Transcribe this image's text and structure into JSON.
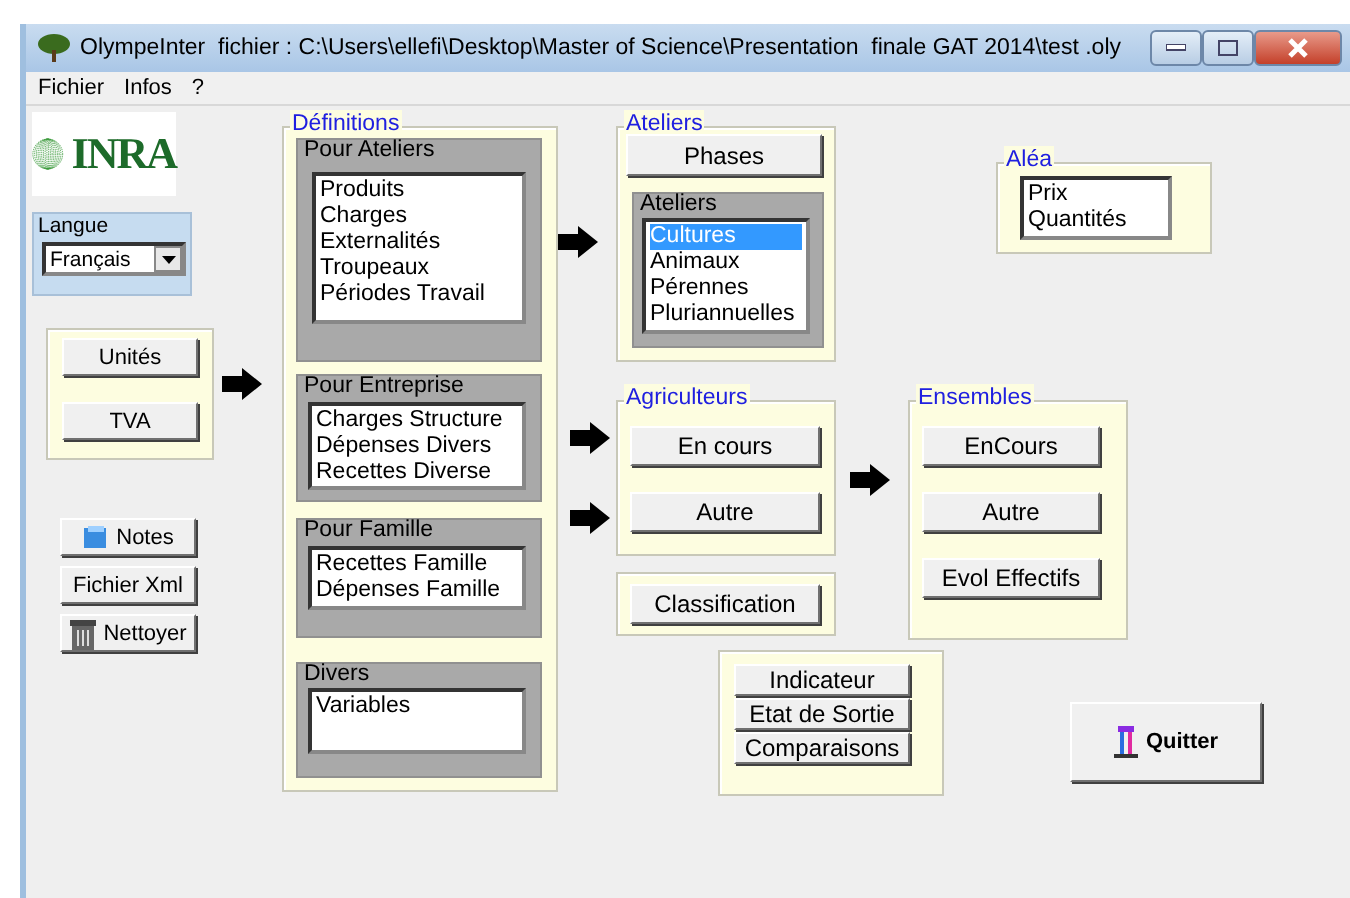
{
  "window": {
    "title": "OlympeInter  fichier : C:\\Users\\ellefi\\Desktop\\Master of Science\\Presentation  finale GAT 2014\\test .oly"
  },
  "menu": [
    "Fichier",
    "Infos",
    "?"
  ],
  "logo": {
    "text": "INRA"
  },
  "langue": {
    "title": "Langue",
    "value": "Français"
  },
  "settings_buttons": [
    "Unités",
    "TVA"
  ],
  "tool_buttons": [
    {
      "label": "Notes",
      "kind": "notes"
    },
    {
      "label": "Fichier Xml",
      "kind": "plain"
    },
    {
      "label": "Nettoyer",
      "kind": "trash"
    }
  ],
  "definitions": {
    "title": "Définitions",
    "groups": [
      {
        "title": "Pour Ateliers",
        "items": [
          {
            "label": "Produits",
            "selected": false
          },
          {
            "label": "Charges",
            "selected": false
          },
          {
            "label": "Externalités",
            "selected": false
          },
          {
            "label": "Troupeaux",
            "selected": false
          },
          {
            "label": "Périodes Travail",
            "selected": false
          }
        ]
      },
      {
        "title": "Pour Entreprise",
        "items": [
          {
            "label": "Charges Structure",
            "selected": false
          },
          {
            "label": "Dépenses Divers",
            "selected": false
          },
          {
            "label": "Recettes Diverse",
            "selected": false
          }
        ]
      },
      {
        "title": "Pour Famille",
        "items": [
          {
            "label": "Recettes Famille",
            "selected": false
          },
          {
            "label": "Dépenses Famille",
            "selected": false
          }
        ]
      },
      {
        "title": "Divers",
        "items": [
          {
            "label": "Variables",
            "selected": false
          }
        ]
      }
    ]
  },
  "ateliers": {
    "title": "Ateliers",
    "button": "Phases",
    "group": {
      "title": "Ateliers",
      "items": [
        {
          "label": "Cultures",
          "selected": true
        },
        {
          "label": "Animaux",
          "selected": false
        },
        {
          "label": "Pérennes",
          "selected": false
        },
        {
          "label": "Pluriannuelles",
          "selected": false
        }
      ]
    }
  },
  "alea": {
    "title": "Aléa",
    "items": [
      {
        "label": "Prix",
        "selected": false
      },
      {
        "label": "Quantités",
        "selected": false
      }
    ]
  },
  "agriculteurs": {
    "title": "Agriculteurs",
    "buttons": [
      "En cours",
      "Autre"
    ]
  },
  "classification": {
    "button": "Classification"
  },
  "ensembles": {
    "title": "Ensembles",
    "buttons": [
      "EnCours",
      "Autre",
      "Evol Effectifs"
    ]
  },
  "outputs": {
    "buttons": [
      "Indicateur",
      "Etat de Sortie",
      "Comparaisons"
    ]
  },
  "quit": {
    "label": "Quitter"
  }
}
